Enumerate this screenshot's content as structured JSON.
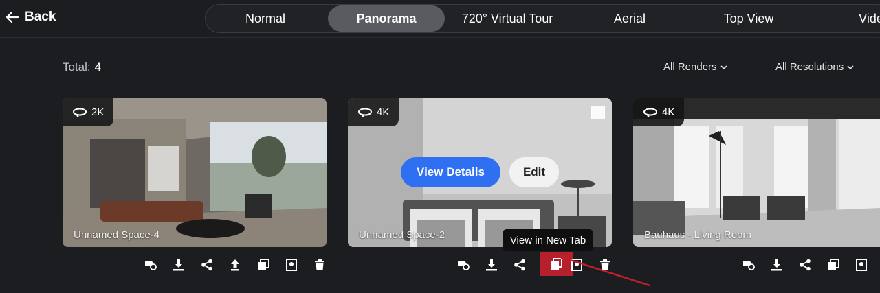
{
  "nav": {
    "back_label": "Back",
    "tabs": [
      {
        "label": "Normal",
        "active": false
      },
      {
        "label": "Panorama",
        "active": true
      },
      {
        "label": "720° Virtual Tour",
        "active": false
      },
      {
        "label": "Aerial",
        "active": false
      },
      {
        "label": "Top View",
        "active": false
      },
      {
        "label": "Vide",
        "active": false
      }
    ]
  },
  "summary": {
    "total_label": "Total:",
    "total_value": "4"
  },
  "filters": {
    "renders": "All Renders",
    "resolutions": "All Resolutions"
  },
  "cards": [
    {
      "resolution": "2K",
      "name": "Unnamed Space-4"
    },
    {
      "resolution": "4K",
      "name": "Unnamed Space-2",
      "details_label": "View Details",
      "edit_label": "Edit"
    },
    {
      "resolution": "4K",
      "name": "Bauhaus - Living Room"
    }
  ],
  "tooltip": "View in New Tab",
  "colors": {
    "accent": "#2f6ff2",
    "highlight": "#b4202b",
    "background": "#1c1d20"
  }
}
